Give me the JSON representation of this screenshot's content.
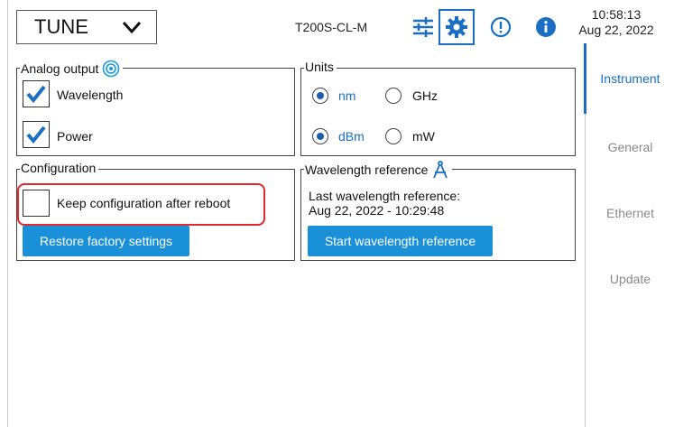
{
  "header": {
    "mode_value": "TUNE",
    "model": "T200S-CL-M",
    "time": "10:58:13",
    "date": "Aug 22, 2022",
    "icons": [
      "chevron-down-icon",
      "sliders-icon",
      "gear-icon",
      "alert-circle-icon",
      "info-icon"
    ]
  },
  "sidebar": {
    "items": [
      {
        "label": "Instrument",
        "active": true
      },
      {
        "label": "General",
        "active": false
      },
      {
        "label": "Ethernet",
        "active": false
      },
      {
        "label": "Update",
        "active": false
      }
    ]
  },
  "analog_output": {
    "title": "Analog output",
    "icon": "target-icon",
    "wavelength": {
      "label": "Wavelength",
      "checked": true
    },
    "power": {
      "label": "Power",
      "checked": true
    }
  },
  "units": {
    "title": "Units",
    "wavelength_options": [
      {
        "label": "nm",
        "selected": true
      },
      {
        "label": "GHz",
        "selected": false
      }
    ],
    "power_options": [
      {
        "label": "dBm",
        "selected": true
      },
      {
        "label": "mW",
        "selected": false
      }
    ]
  },
  "configuration": {
    "title": "Configuration",
    "keep_label": "Keep configuration after reboot",
    "keep_checked": false,
    "restore_button": "Restore factory settings"
  },
  "wavelength_reference": {
    "title": "Wavelength reference",
    "icon": "compass-icon",
    "last_label": "Last wavelength reference:",
    "last_value": "Aug 22, 2022 - 10:29:48",
    "start_button": "Start wavelength reference"
  },
  "colors": {
    "accent": "#1a6fc4",
    "button": "#1a90d9",
    "highlight": "#e0282e",
    "inactive_text": "#8a8a8a"
  }
}
